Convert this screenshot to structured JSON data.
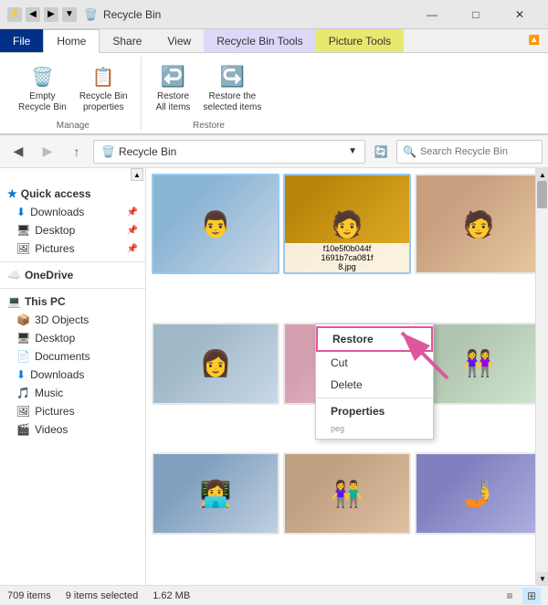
{
  "titleBar": {
    "title": "Recycle Bin",
    "minimize": "—",
    "maximize": "□",
    "close": "✕"
  },
  "tabs": [
    {
      "label": "File",
      "active": false,
      "highlighted": false
    },
    {
      "label": "Home",
      "active": true,
      "highlighted": false
    },
    {
      "label": "Share",
      "active": false,
      "highlighted": false
    },
    {
      "label": "View",
      "active": false,
      "highlighted": false
    },
    {
      "label": "Recycle Bin Tools",
      "active": false,
      "highlighted": true
    },
    {
      "label": "Picture Tools",
      "active": false,
      "highlighted2": true
    }
  ],
  "ribbon": {
    "groups": [
      {
        "label": "Manage",
        "buttons": [
          {
            "id": "empty",
            "label": "Empty\nRecycle Bin",
            "icon": "🗑️"
          },
          {
            "id": "properties",
            "label": "Recycle Bin\nproperties",
            "icon": "🗂️"
          }
        ]
      },
      {
        "label": "Restore",
        "buttons": [
          {
            "id": "restore-all",
            "label": "Restore\nAll items",
            "icon": "↩"
          },
          {
            "id": "restore-selected",
            "label": "Restore the\nselected items",
            "icon": "↪"
          }
        ]
      }
    ]
  },
  "addressBar": {
    "backDisabled": false,
    "forwardDisabled": true,
    "upDisabled": false,
    "path": "Recycle Bin",
    "searchPlaceholder": "Search Recycle Bin"
  },
  "sidebar": {
    "quickAccess": {
      "label": "Quick access",
      "items": [
        {
          "label": "Downloads",
          "icon": "⬇️",
          "pinned": true
        },
        {
          "label": "Desktop",
          "icon": "🖥️",
          "pinned": true
        },
        {
          "label": "Pictures",
          "icon": "🖼️",
          "pinned": true
        }
      ]
    },
    "oneDrive": {
      "label": "OneDrive",
      "icon": "☁️"
    },
    "thisPC": {
      "label": "This PC",
      "icon": "💻",
      "items": [
        {
          "label": "3D Objects",
          "icon": "📦"
        },
        {
          "label": "Desktop",
          "icon": "🖥️"
        },
        {
          "label": "Documents",
          "icon": "📄"
        },
        {
          "label": "Downloads",
          "icon": "⬇️"
        },
        {
          "label": "Music",
          "icon": "🎵"
        },
        {
          "label": "Pictures",
          "icon": "🖼️"
        },
        {
          "label": "Videos",
          "icon": "🎬"
        }
      ]
    }
  },
  "contextMenu": {
    "items": [
      {
        "label": "Restore",
        "bold": true,
        "highlighted": true
      },
      {
        "label": "Cut",
        "bold": false
      },
      {
        "label": "Delete",
        "bold": false
      },
      {
        "label": "Properties",
        "bold": true
      }
    ]
  },
  "files": [
    {
      "id": 1,
      "selected": true,
      "label": "",
      "photoClass": "photo1"
    },
    {
      "id": 2,
      "selected": false,
      "label": "",
      "photoClass": "photo2"
    },
    {
      "id": 3,
      "selected": false,
      "label": "",
      "photoClass": "photo3"
    },
    {
      "id": 4,
      "selected": true,
      "label": "f10e5f0b044f\n1691b7ca081f\n8.jpg",
      "photoClass": "photo4"
    },
    {
      "id": 5,
      "selected": false,
      "label": "",
      "photoClass": "photo5"
    },
    {
      "id": 6,
      "selected": false,
      "label": "",
      "photoClass": "photo6"
    },
    {
      "id": 7,
      "selected": false,
      "label": "",
      "photoClass": "photo7"
    },
    {
      "id": 8,
      "selected": false,
      "label": "",
      "photoClass": "photo8"
    },
    {
      "id": 9,
      "selected": false,
      "label": "",
      "photoClass": "photo9"
    }
  ],
  "statusBar": {
    "itemCount": "709 items",
    "selected": "9 items selected",
    "size": "1.62 MB"
  }
}
